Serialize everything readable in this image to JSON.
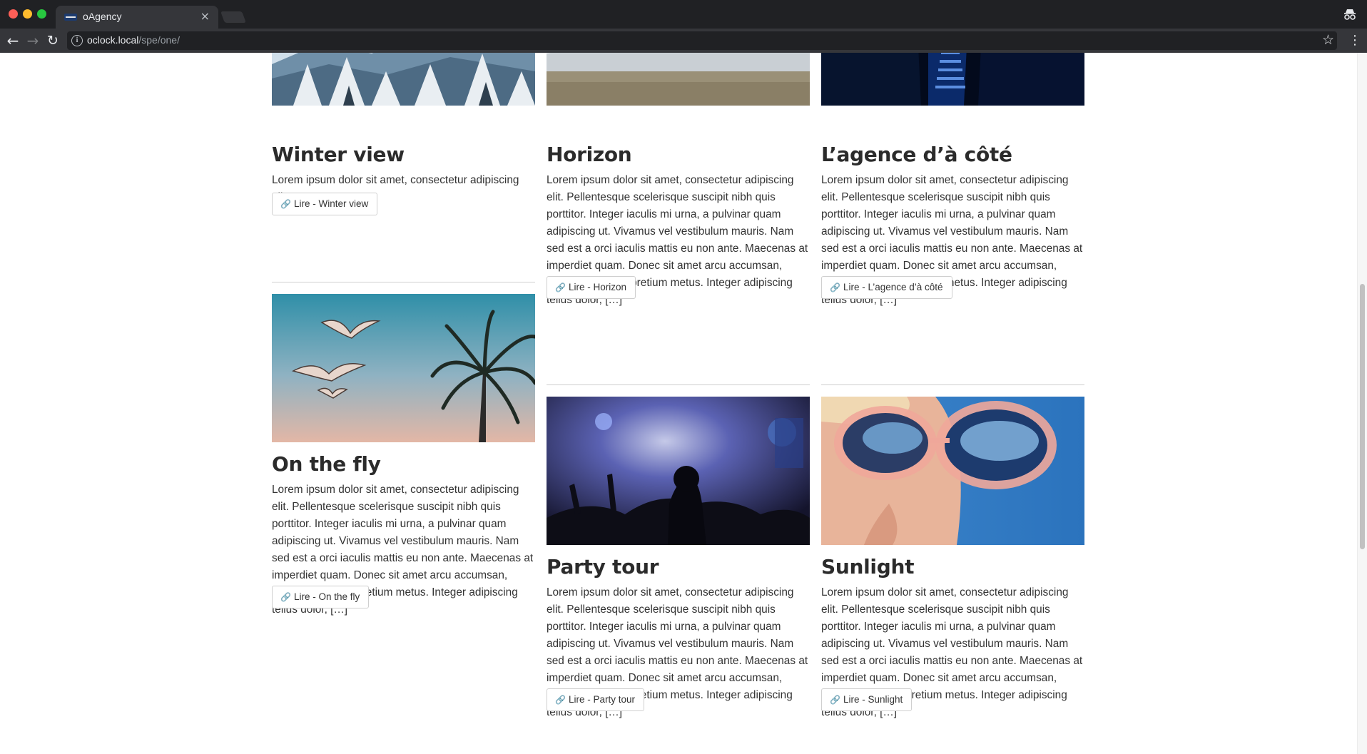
{
  "browser": {
    "tab_title": "oAgency",
    "tab_close": "×",
    "url_host": "oclock.local",
    "url_path": "/spe/one/"
  },
  "button_icon": "link-icon",
  "cards": [
    {
      "title": "Winter view",
      "text": "Lorem ipsum dolor sit amet, consectetur adipiscing elit.",
      "button": "Lire - Winter view",
      "image": "snowy-mountain-forest"
    },
    {
      "title": "Horizon",
      "text": "Lorem ipsum dolor sit amet, consectetur adipiscing elit. Pellentesque scelerisque suscipit nibh quis porttitor. Integer iaculis mi urna, a pulvinar quam adipiscing ut. Vivamus vel vestibulum mauris. Nam sed est a orci iaculis mattis eu non ante. Maecenas at imperdiet quam. Donec sit amet arcu accumsan, posuere nulla at, pretium metus. Integer adipiscing tellus dolor, […]",
      "button": "Lire - Horizon",
      "image": "snowy-plain-horizon"
    },
    {
      "title": "L’agence d’à côté",
      "text": "Lorem ipsum dolor sit amet, consectetur adipiscing elit. Pellentesque scelerisque suscipit nibh quis porttitor. Integer iaculis mi urna, a pulvinar quam adipiscing ut. Vivamus vel vestibulum mauris. Nam sed est a orci iaculis mattis eu non ante. Maecenas at imperdiet quam. Donec sit amet arcu accumsan, posuere nulla at, pretium metus. Integer adipiscing tellus dolor, […]",
      "button": "Lire - L’agence d’à côté",
      "image": "blue-alley-stairs"
    },
    {
      "title": "On the fly",
      "text": "Lorem ipsum dolor sit amet, consectetur adipiscing elit. Pellentesque scelerisque suscipit nibh quis porttitor. Integer iaculis mi urna, a pulvinar quam adipiscing ut. Vivamus vel vestibulum mauris. Nam sed est a orci iaculis mattis eu non ante. Maecenas at imperdiet quam. Donec sit amet arcu accumsan, posuere nulla at, pretium metus. Integer adipiscing tellus dolor, […]",
      "button": "Lire - On the fly",
      "image": "seagulls-palm-tree"
    },
    {
      "title": "Party tour",
      "text": "Lorem ipsum dolor sit amet, consectetur adipiscing elit. Pellentesque scelerisque suscipit nibh quis porttitor. Integer iaculis mi urna, a pulvinar quam adipiscing ut. Vivamus vel vestibulum mauris. Nam sed est a orci iaculis mattis eu non ante. Maecenas at imperdiet quam. Donec sit amet arcu accumsan, posuere nulla at, pretium metus. Integer adipiscing tellus dolor, […]",
      "button": "Lire - Party tour",
      "image": "concert-crowd"
    },
    {
      "title": "Sunlight",
      "text": "Lorem ipsum dolor sit amet, consectetur adipiscing elit. Pellentesque scelerisque suscipit nibh quis porttitor. Integer iaculis mi urna, a pulvinar quam adipiscing ut. Vivamus vel vestibulum mauris. Nam sed est a orci iaculis mattis eu non ante. Maecenas at imperdiet quam. Donec sit amet arcu accumsan, posuere nulla at, pretium metus. Integer adipiscing tellus dolor, […]",
      "button": "Lire - Sunlight",
      "image": "sunglasses-closeup"
    }
  ]
}
